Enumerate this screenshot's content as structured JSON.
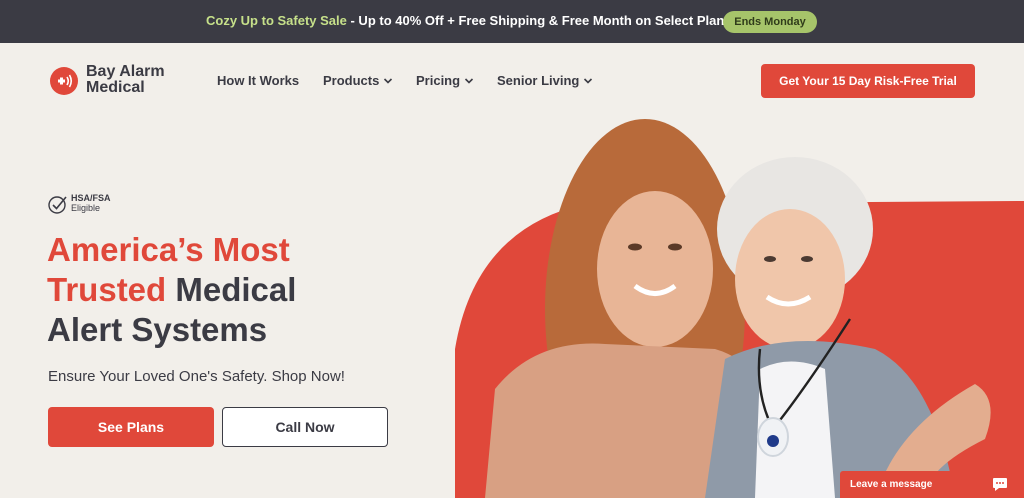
{
  "promo": {
    "highlight": "Cozy Up to Safety Sale",
    "text": " - Up to 40% Off + Free Shipping & Free Month on Select Plans",
    "badge": "Ends Monday"
  },
  "brand": {
    "line1": "Bay Alarm",
    "line2": "Medical",
    "icon": "alarm-signal-icon"
  },
  "nav": {
    "items": [
      {
        "label": "How It Works",
        "dropdown": false
      },
      {
        "label": "Products",
        "dropdown": true
      },
      {
        "label": "Pricing",
        "dropdown": true
      },
      {
        "label": "Senior Living",
        "dropdown": true
      }
    ],
    "cta": "Get Your 15 Day Risk-Free Trial"
  },
  "hero": {
    "badge_line1": "HSA/FSA",
    "badge_line2": "Eligible",
    "headline_red1": "America’s Most",
    "headline_red2": "Trusted",
    "headline_dark2": " Medical",
    "headline_dark3": "Alert Systems",
    "subhead": "Ensure Your Loved One's Safety. Shop Now!",
    "primary_button": "See Plans",
    "secondary_button": "Call Now"
  },
  "chat": {
    "label": "Leave a message",
    "icon": "chat-bubble-icon"
  },
  "colors": {
    "brand_red": "#e0483a",
    "dark": "#3b3b44",
    "background": "#f2efea",
    "promo_highlight": "#c6e08a",
    "promo_badge": "#a6c46a"
  }
}
